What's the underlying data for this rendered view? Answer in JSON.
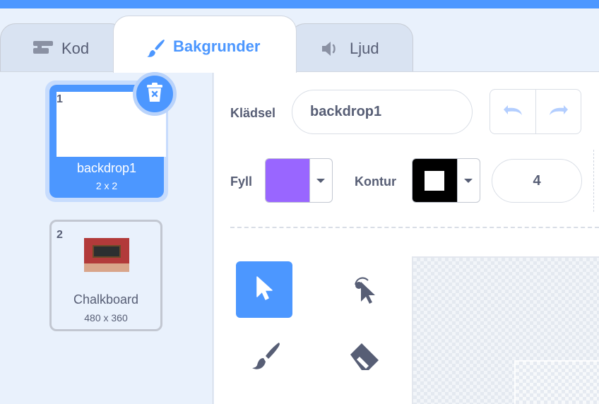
{
  "tabs": {
    "code": {
      "label": "Kod",
      "icon": "code-blocks-icon"
    },
    "backdrops": {
      "label": "Bakgrunder",
      "icon": "paintbrush-icon"
    },
    "sounds": {
      "label": "Ljud",
      "icon": "speaker-icon"
    }
  },
  "backdrops": [
    {
      "number": "1",
      "name": "backdrop1",
      "size": "2 x 2",
      "selected": true
    },
    {
      "number": "2",
      "name": "Chalkboard",
      "size": "480 x 360",
      "selected": false
    }
  ],
  "editor": {
    "costume_label": "Klädsel",
    "costume_name": "backdrop1",
    "fill_label": "Fyll",
    "fill_color": "#9966ff",
    "outline_label": "Kontur",
    "outline_color": "#000000",
    "outline_width": "4"
  },
  "tools": [
    {
      "name": "select",
      "icon": "arrow-select-icon",
      "active": true
    },
    {
      "name": "reshape",
      "icon": "reshape-icon",
      "active": false
    },
    {
      "name": "brush",
      "icon": "brush-icon",
      "active": false
    },
    {
      "name": "eraser",
      "icon": "eraser-icon",
      "active": false
    }
  ],
  "colors": {
    "accent": "#4c97ff",
    "text": "#575e75",
    "background": "#e9f1fc"
  }
}
